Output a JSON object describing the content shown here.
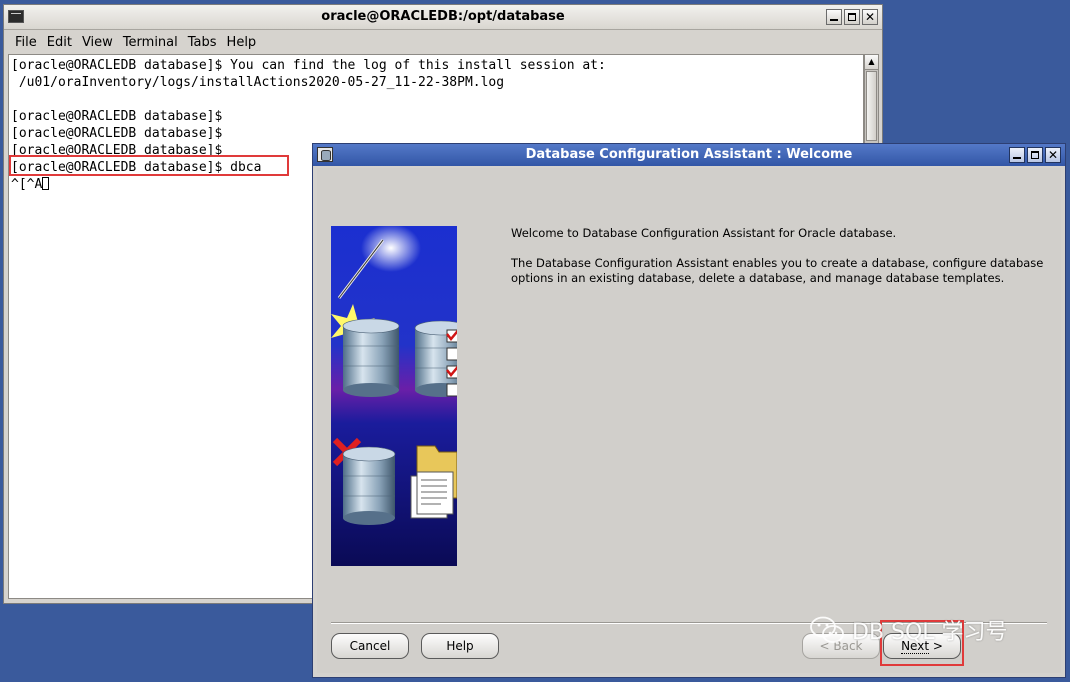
{
  "terminal": {
    "title": "oracle@ORACLEDB:/opt/database",
    "menu": [
      "File",
      "Edit",
      "View",
      "Terminal",
      "Tabs",
      "Help"
    ],
    "lines": [
      "[oracle@ORACLEDB database]$ You can find the log of this install session at:",
      " /u01/oraInventory/logs/installActions2020-05-27_11-22-38PM.log",
      "",
      "[oracle@ORACLEDB database]$",
      "[oracle@ORACLEDB database]$",
      "[oracle@ORACLEDB database]$",
      "[oracle@ORACLEDB database]$ dbca",
      "^[^A"
    ]
  },
  "dbca": {
    "title": "Database Configuration Assistant : Welcome",
    "welcome_1": "Welcome to Database Configuration Assistant for Oracle database.",
    "welcome_2": "The Database Configuration Assistant enables you to create a database, configure database options in an existing database, delete a database, and manage database templates.",
    "buttons": {
      "cancel": "Cancel",
      "help": "Help",
      "back": "< Back",
      "next": "Next",
      "next_arrows": ">"
    }
  },
  "watermark": "DB SQL 学习号",
  "colors": {
    "desktop": "#3a5a9c",
    "dialog_title": "#3f63b2",
    "highlight": "#e03a3a"
  }
}
